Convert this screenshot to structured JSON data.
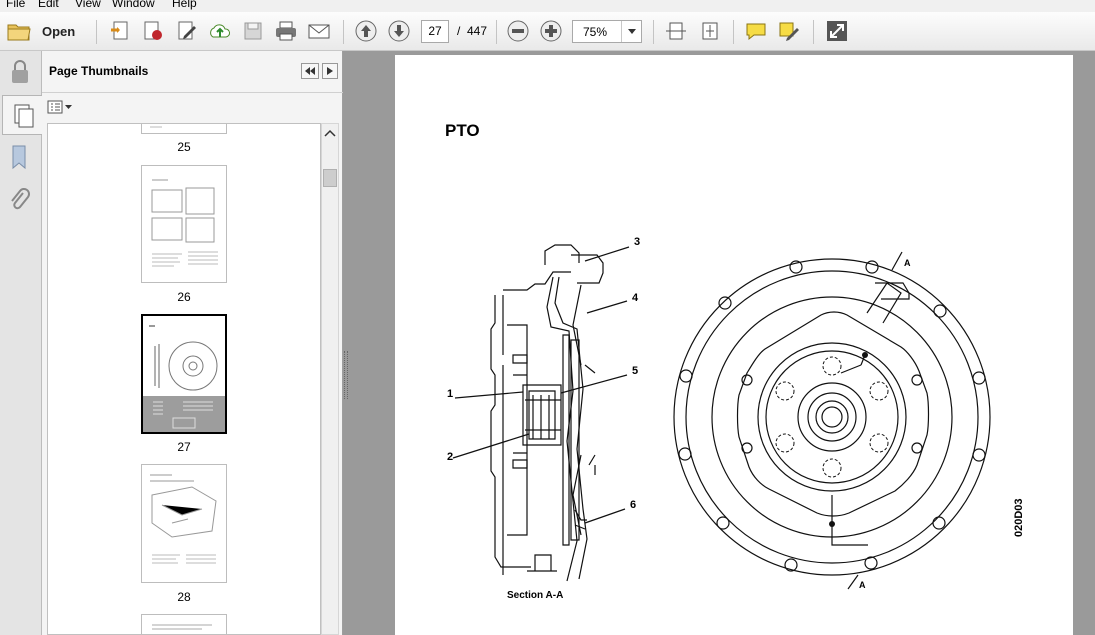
{
  "menu": [
    "File",
    "Edit",
    "View",
    "Window",
    "Help"
  ],
  "toolbar": {
    "open_label": "Open",
    "current_page": "27",
    "page_separator": "/",
    "total_pages": "447",
    "zoom": "75%"
  },
  "panel": {
    "title": "Page Thumbnails",
    "thumbnails": [
      {
        "label": "25"
      },
      {
        "label": "26"
      },
      {
        "label": "27",
        "selected": true
      },
      {
        "label": "28"
      }
    ]
  },
  "document": {
    "heading": "PTO",
    "callouts": [
      "1",
      "2",
      "3",
      "4",
      "5",
      "6"
    ],
    "section_label": "Section A-A",
    "section_marker": "A",
    "drawing_code": "020D03"
  },
  "colors": {
    "toolbar_bg": "#ececec",
    "viewer_bg": "#9a9a9a",
    "selection": "#000000"
  }
}
